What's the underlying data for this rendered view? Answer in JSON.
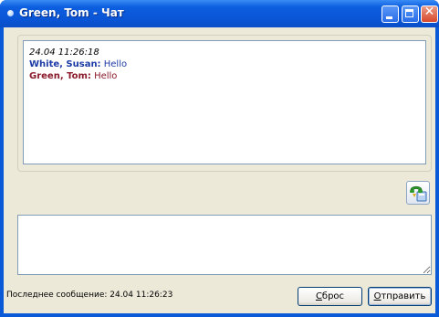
{
  "window": {
    "title": "Green, Tom - Чат",
    "controls": {
      "minimize": "minimize",
      "maximize": "maximize",
      "close": "✕"
    }
  },
  "chat": {
    "timestamp": "24.04 11:26:18",
    "messages": [
      {
        "sender": "White, Susan:",
        "text": " Hello",
        "color": "#1c3aa6"
      },
      {
        "sender": "Green, Tom:",
        "text": " Hello",
        "color": "#8a1a2a"
      }
    ]
  },
  "input": {
    "value": ""
  },
  "icons": {
    "action": "phone-transfer-icon"
  },
  "footer": {
    "status": "Последнее сообщение: 24.04 11:26:23",
    "reset_hotkey": "С",
    "reset_rest": "брос",
    "send_hotkey": "О",
    "send_rest": "тправить"
  },
  "colors": {
    "titlebar": "#0a55d6",
    "surface": "#ece9d8",
    "close": "#d7482b"
  }
}
